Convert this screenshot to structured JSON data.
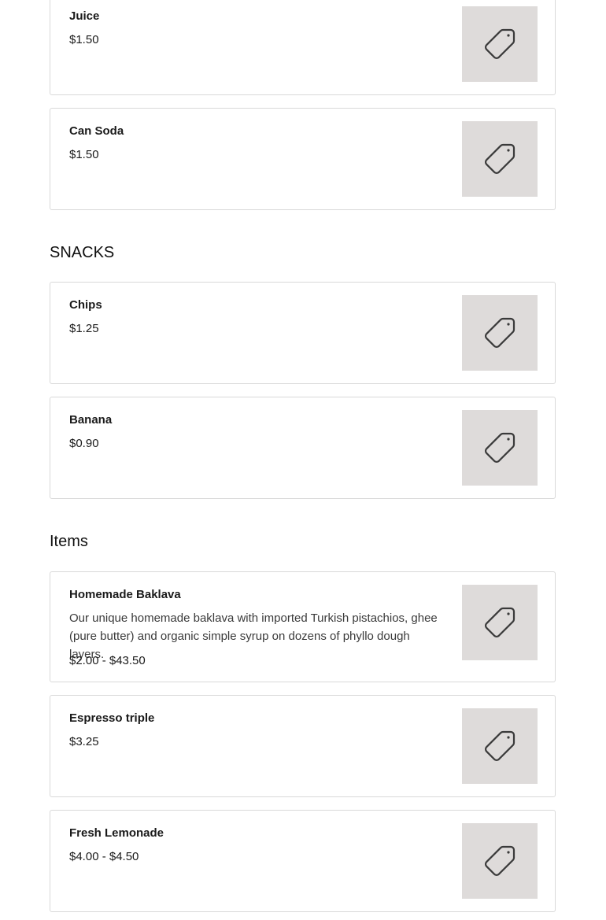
{
  "sections": {
    "snacks_title": "SNACKS",
    "items_title": "Items"
  },
  "items": {
    "juice": {
      "name": "Juice",
      "price": "$1.50"
    },
    "can_soda": {
      "name": "Can Soda",
      "price": "$1.50"
    },
    "chips": {
      "name": "Chips",
      "price": "$1.25"
    },
    "banana": {
      "name": "Banana",
      "price": "$0.90"
    },
    "baklava": {
      "name": "Homemade Baklava",
      "description": "Our unique homemade baklava with imported Turkish pistachios, ghee (pure butter) and organic simple syrup on dozens of phyllo dough layers.",
      "price": "$2.00 - $43.50"
    },
    "espresso": {
      "name": "Espresso triple",
      "price": "$3.25"
    },
    "lemonade": {
      "name": "Fresh Lemonade",
      "price": "$4.00 - $4.50"
    }
  },
  "icons": {
    "placeholder": "price-tag-icon"
  },
  "colors": {
    "thumb_bg": "#dedbda",
    "border": "#d9d9d9",
    "icon_stroke": "#3a3a3a"
  }
}
